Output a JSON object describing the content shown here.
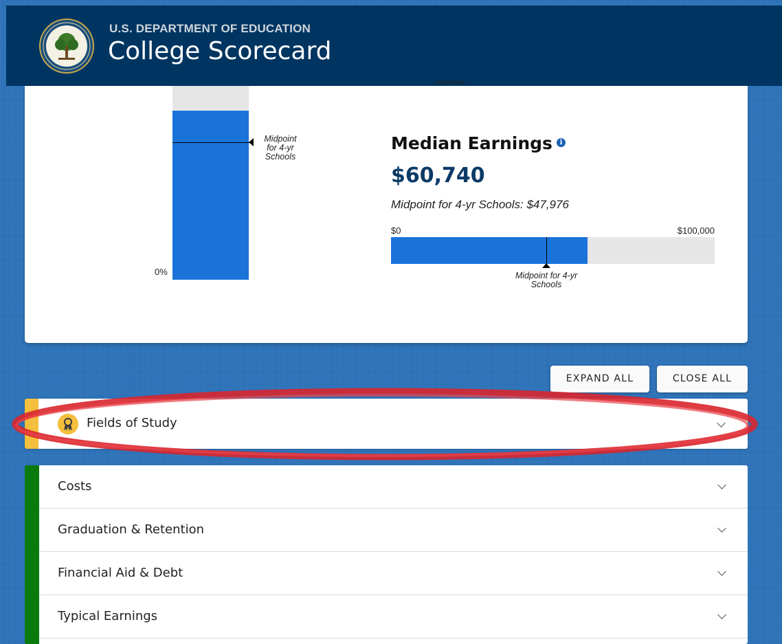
{
  "header": {
    "department": "U.S. DEPARTMENT OF EDUCATION",
    "brand": "College Scorecard",
    "seal_text": "DEPARTMENT OF EDUCATION · UNITED STATES OF AMERICA"
  },
  "graduation_chart": {
    "top_label_fragment": "Schools",
    "zero_label": "0%",
    "midpoint_label": "Midpoint for 4-yr Schools"
  },
  "median_earnings": {
    "title": "Median Earnings",
    "info_icon": "i",
    "value": "$60,740",
    "midpoint_text": "Midpoint for 4-yr Schools: $47,976",
    "scale_min": "$0",
    "scale_max": "$100,000",
    "midpoint_label": "Midpoint for 4-yr Schools",
    "school_value_fraction": 0.6074,
    "midpoint_value_fraction": 0.47976
  },
  "actions": {
    "expand_all": "EXPAND ALL",
    "close_all": "CLOSE ALL"
  },
  "fields_of_study": {
    "label": "Fields of Study",
    "icon": "award-ribbon-icon"
  },
  "accordion": {
    "items": [
      {
        "label": "Costs"
      },
      {
        "label": "Graduation & Retention"
      },
      {
        "label": "Financial Aid & Debt"
      },
      {
        "label": "Typical Earnings"
      }
    ]
  },
  "colors": {
    "header": "#003561",
    "bar_fill": "#1a73d9",
    "bar_bg": "#e6e6e6",
    "accent_yellow": "#f4bf3c",
    "accent_green": "#0a7a0c",
    "annotation_red": "#d9262e"
  }
}
